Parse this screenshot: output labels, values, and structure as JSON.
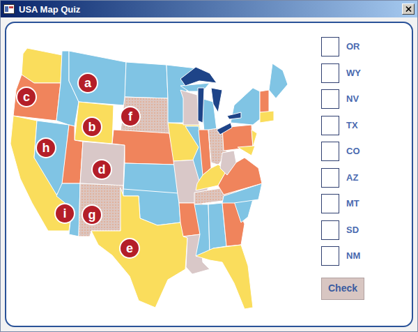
{
  "window": {
    "title": "USA Map Quiz"
  },
  "map": {
    "markers": [
      {
        "label": "a"
      },
      {
        "label": "b"
      },
      {
        "label": "c"
      },
      {
        "label": "d"
      },
      {
        "label": "e"
      },
      {
        "label": "f"
      },
      {
        "label": "g"
      },
      {
        "label": "h"
      },
      {
        "label": "i"
      }
    ]
  },
  "answers": [
    {
      "label": "OR",
      "checked": false
    },
    {
      "label": "WY",
      "checked": false
    },
    {
      "label": "NV",
      "checked": false
    },
    {
      "label": "TX",
      "checked": false
    },
    {
      "label": "CO",
      "checked": false
    },
    {
      "label": "AZ",
      "checked": false
    },
    {
      "label": "MT",
      "checked": false
    },
    {
      "label": "SD",
      "checked": false
    },
    {
      "label": "NM",
      "checked": false
    }
  ],
  "buttons": [
    "Check"
  ]
}
